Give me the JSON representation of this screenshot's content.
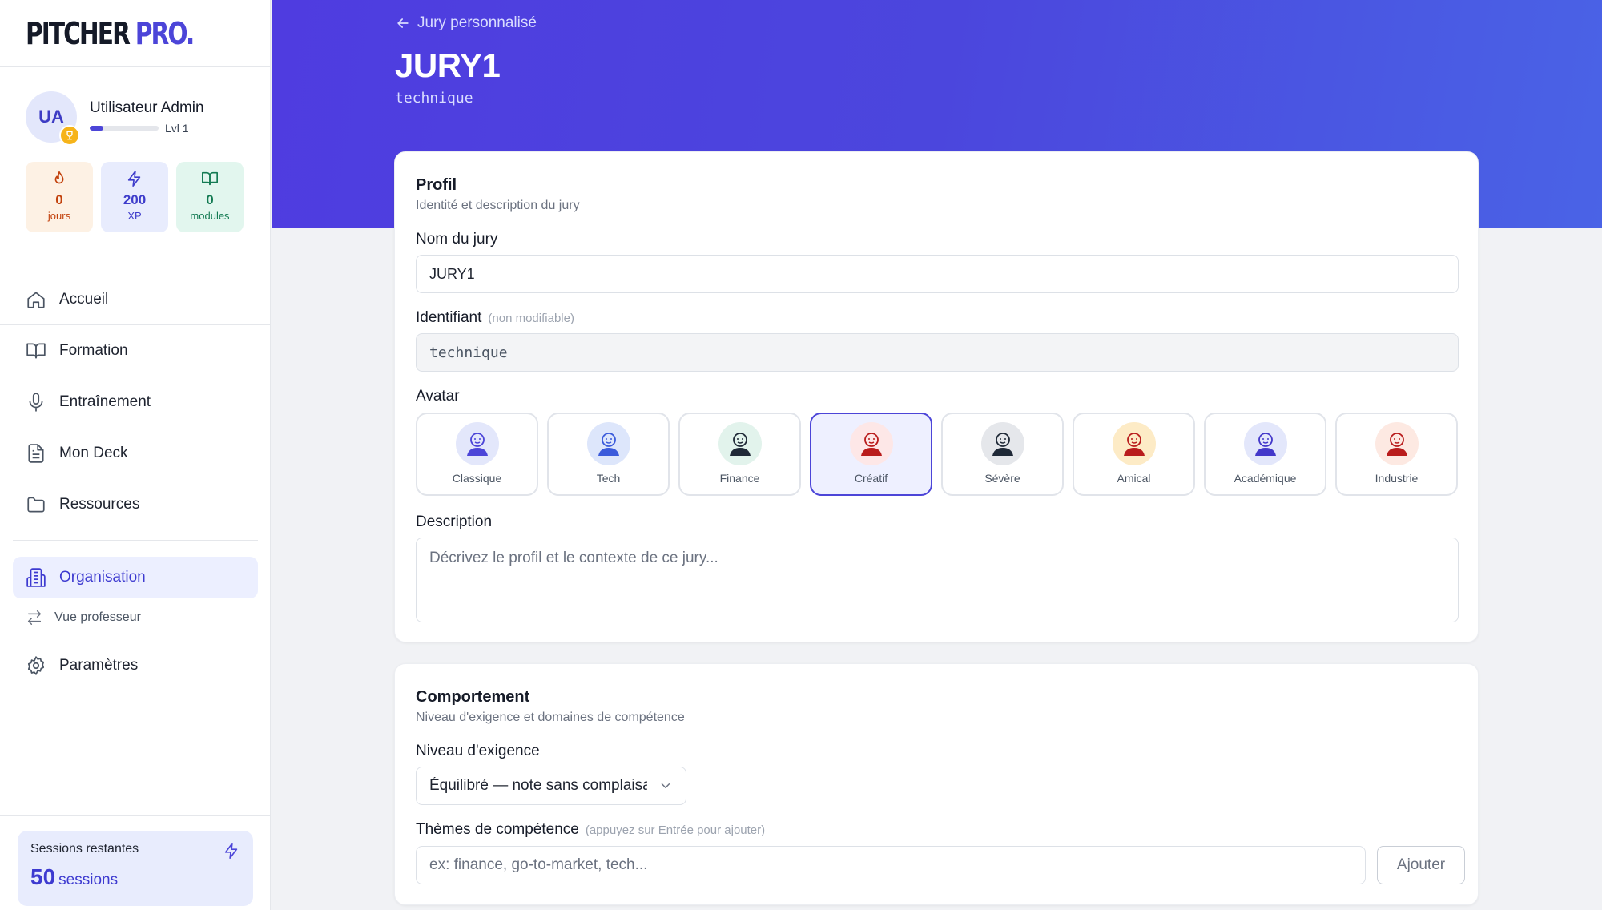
{
  "brand": {
    "part1": "PITCHER",
    "part2": "PRO.",
    "accent_color": "#4c45d8"
  },
  "user": {
    "initials": "UA",
    "name": "Utilisateur Admin",
    "level_label": "Lvl 1",
    "level_progress": 0.2,
    "stats": [
      {
        "value": "0",
        "label": "jours",
        "icon": "flame-icon"
      },
      {
        "value": "200",
        "label": "XP",
        "icon": "bolt-icon"
      },
      {
        "value": "0",
        "label": "modules",
        "icon": "book-icon"
      }
    ]
  },
  "nav": {
    "items": [
      {
        "label": "Accueil",
        "icon": "home-icon"
      },
      {
        "label": "Formation",
        "icon": "book-icon"
      },
      {
        "label": "Entraînement",
        "icon": "mic-icon"
      },
      {
        "label": "Mon Deck",
        "icon": "document-icon"
      },
      {
        "label": "Ressources",
        "icon": "folder-icon"
      }
    ],
    "organisation": "Organisation",
    "vue_professeur": "Vue professeur",
    "parametres": "Paramètres"
  },
  "sessions": {
    "title": "Sessions restantes",
    "count": "50",
    "unit": "sessions"
  },
  "header": {
    "back": "Jury personnalisé",
    "title": "JURY1",
    "subtitle": "technique"
  },
  "profil": {
    "title": "Profil",
    "subtitle": "Identité et description du jury",
    "nom_label": "Nom du jury",
    "nom_value": "JURY1",
    "id_label": "Identifiant",
    "id_hint": "(non modifiable)",
    "id_value": "technique",
    "avatar_label": "Avatar",
    "avatars": [
      {
        "label": "Classique",
        "color": "#4c45d8",
        "bg": "#e3e7fb"
      },
      {
        "label": "Tech",
        "color": "#3b5bdb",
        "bg": "#dde6fb"
      },
      {
        "label": "Finance",
        "color": "#1f2937",
        "bg": "#e2f3ec"
      },
      {
        "label": "Créatif",
        "color": "#b91c1c",
        "bg": "#fde7e7"
      },
      {
        "label": "Sévère",
        "color": "#1f2937",
        "bg": "#e5e7eb"
      },
      {
        "label": "Amical",
        "color": "#b91c1c",
        "bg": "#fdebc6"
      },
      {
        "label": "Académique",
        "color": "#4338ca",
        "bg": "#e3e7fb"
      },
      {
        "label": "Industrie",
        "color": "#b91c1c",
        "bg": "#fde9e2"
      }
    ],
    "selected_avatar": "Créatif",
    "desc_label": "Description",
    "desc_placeholder": "Décrivez le profil et le contexte de ce jury..."
  },
  "comportement": {
    "title": "Comportement",
    "subtitle": "Niveau d'exigence et domaines de compétence",
    "niveau_label": "Niveau d'exigence",
    "niveau_value": "Équilibré — note sans complaisance",
    "themes_label": "Thèmes de compétence",
    "themes_hint": "(appuyez sur Entrée pour ajouter)",
    "themes_placeholder": "ex: finance, go-to-market, tech...",
    "add_label": "Ajouter"
  }
}
